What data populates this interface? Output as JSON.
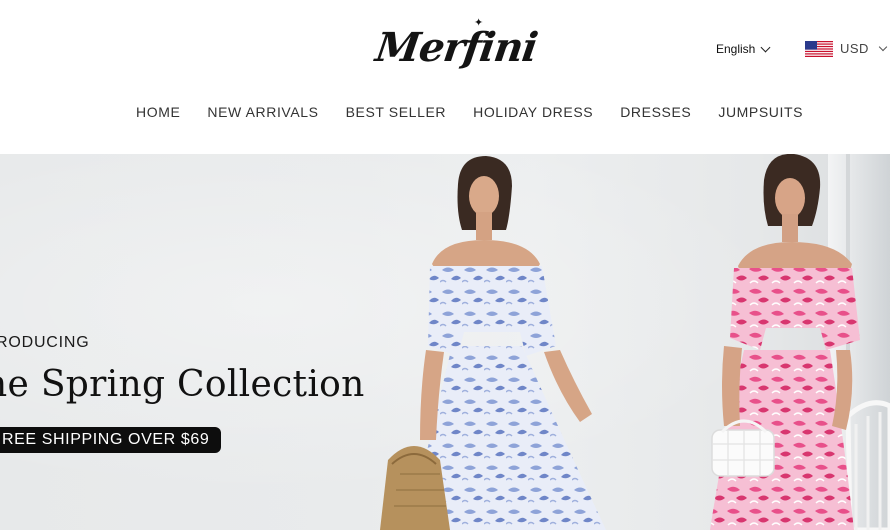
{
  "header": {
    "logo_text": "Merfini",
    "language": {
      "selected": "English"
    },
    "currency": {
      "selected": "USD",
      "flag": "us-flag"
    }
  },
  "nav": {
    "items": [
      {
        "label": "HOME"
      },
      {
        "label": "NEW ARRIVALS"
      },
      {
        "label": "BEST SELLER"
      },
      {
        "label": "HOLIDAY DRESS"
      },
      {
        "label": "DRESSES"
      },
      {
        "label": "JUMPSUITS"
      }
    ]
  },
  "hero": {
    "intro": "RODUCING",
    "headline": "he Spring Collection",
    "promo": "REE SHIPPING OVER $69"
  },
  "colors": {
    "brand_text": "#141414",
    "promo_bg": "#0d0d0d",
    "dress_blue": "#8ea3d8",
    "dress_pink": "#e8508a"
  }
}
